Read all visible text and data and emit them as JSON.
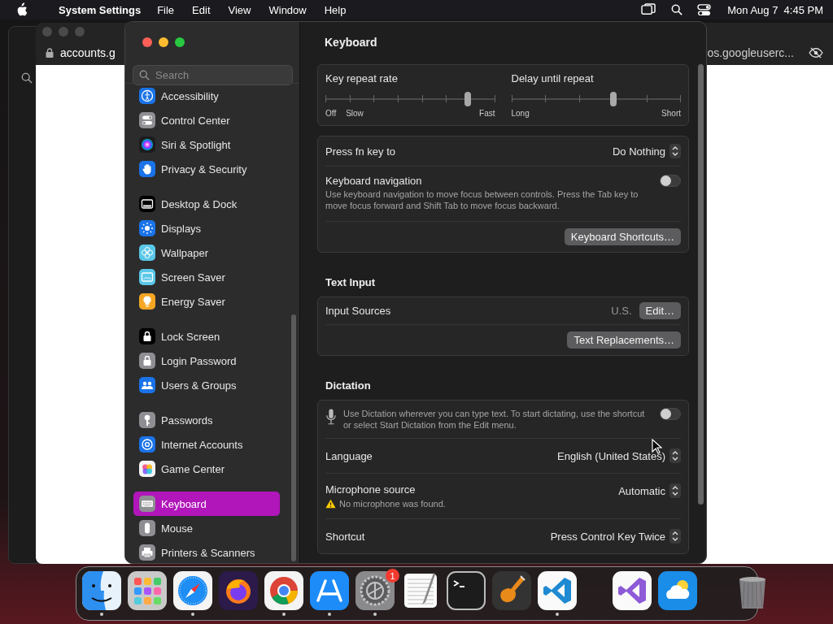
{
  "menu_bar": {
    "app_name": "System Settings",
    "menus": [
      "File",
      "Edit",
      "View",
      "Window",
      "Help"
    ],
    "clock": "Mon Aug 7  4:45 PM"
  },
  "browser_window": {
    "address": "accounts.g",
    "address_right": "os.googleuserc..."
  },
  "sidebar": {
    "search": {
      "placeholder": "Search"
    },
    "groups": [
      {
        "items": [
          {
            "label": "Accessibility",
            "selected": false
          },
          {
            "label": "Control Center",
            "selected": false
          },
          {
            "label": "Siri & Spotlight",
            "selected": false
          },
          {
            "label": "Privacy & Security",
            "selected": false
          }
        ]
      },
      {
        "items": [
          {
            "label": "Desktop & Dock",
            "selected": false
          },
          {
            "label": "Displays",
            "selected": false
          },
          {
            "label": "Wallpaper",
            "selected": false
          },
          {
            "label": "Screen Saver",
            "selected": false
          },
          {
            "label": "Energy Saver",
            "selected": false
          }
        ]
      },
      {
        "items": [
          {
            "label": "Lock Screen",
            "selected": false
          },
          {
            "label": "Login Password",
            "selected": false
          },
          {
            "label": "Users & Groups",
            "selected": false
          }
        ]
      },
      {
        "items": [
          {
            "label": "Passwords",
            "selected": false
          },
          {
            "label": "Internet Accounts",
            "selected": false
          },
          {
            "label": "Game Center",
            "selected": false
          }
        ]
      },
      {
        "items": [
          {
            "label": "Keyboard",
            "selected": true
          },
          {
            "label": "Mouse",
            "selected": false
          },
          {
            "label": "Printers & Scanners",
            "selected": false
          }
        ]
      }
    ]
  },
  "content": {
    "title": "Keyboard",
    "sliders": [
      {
        "label": "Key repeat rate",
        "level": 0.84,
        "scale": [
          "Off",
          "Slow",
          "Fast"
        ]
      },
      {
        "label": "Delay until repeat",
        "level": 0.6,
        "scale": [
          "Long",
          "Short"
        ]
      }
    ],
    "fn_key": {
      "label": "Press fn key to",
      "value": "Do Nothing"
    },
    "keyboard_navigation": {
      "label": "Keyboard navigation",
      "description": "Use keyboard navigation to move focus between controls. Press the Tab key to move focus forward and Shift Tab to move focus backward.",
      "on": false
    },
    "keyboard_shortcuts_button": "Keyboard Shortcuts…",
    "text_input": {
      "heading": "Text Input",
      "input_sources": {
        "label": "Input Sources",
        "value": "U.S.",
        "button": "Edit…"
      },
      "replacements_button": "Text Replacements…"
    },
    "dictation": {
      "heading": "Dictation",
      "description": "Use Dictation wherever you can type text. To start dictating, use the shortcut or select Start Dictation from the Edit menu.",
      "on": false,
      "rows": [
        {
          "label": "Language",
          "value": "English (United States)"
        },
        {
          "label": "Microphone source",
          "value": "Automatic",
          "warning": "No microphone was found."
        },
        {
          "label": "Shortcut",
          "value": "Press Control Key Twice"
        }
      ]
    }
  },
  "dock": {
    "sections": [
      {
        "items": [
          {
            "running": true
          },
          {
            "running": false
          },
          {
            "running": true
          },
          {
            "running": false
          },
          {
            "running": true
          },
          {
            "running": true
          },
          {
            "running": true,
            "badge": "1"
          },
          {
            "running": false
          },
          {
            "running": false
          },
          {
            "running": false
          },
          {
            "running": true
          }
        ]
      },
      {
        "items": [
          {
            "running": false
          },
          {
            "running": false
          }
        ]
      },
      {
        "items": [
          {
            "running": false
          }
        ]
      }
    ]
  }
}
